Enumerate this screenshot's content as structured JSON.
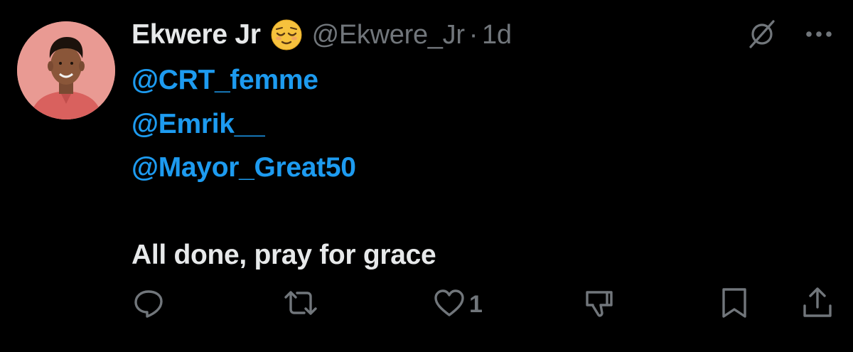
{
  "tweet": {
    "display_name": "Ekwere Jr",
    "handle": "@Ekwere_Jr",
    "separator": "·",
    "time": "1d",
    "mentions": [
      "@CRT_femme",
      "@Emrik__",
      "@Mayor_Great50"
    ],
    "message": "All done, pray for grace"
  },
  "header_icons": [
    "grok-icon",
    "more-options-icon"
  ],
  "actions": {
    "reply": {
      "icon": "reply-icon",
      "count": ""
    },
    "repost": {
      "icon": "repost-icon",
      "count": ""
    },
    "like": {
      "icon": "heart-icon",
      "count": "1"
    },
    "dislike": {
      "icon": "thumbs-down-icon",
      "count": ""
    },
    "bookmark": {
      "icon": "bookmark-icon",
      "count": ""
    },
    "share": {
      "icon": "share-icon",
      "count": ""
    }
  },
  "colors": {
    "background": "#000000",
    "text_primary": "#e7e9ea",
    "text_secondary": "#71767b",
    "link": "#1d9bf0"
  }
}
